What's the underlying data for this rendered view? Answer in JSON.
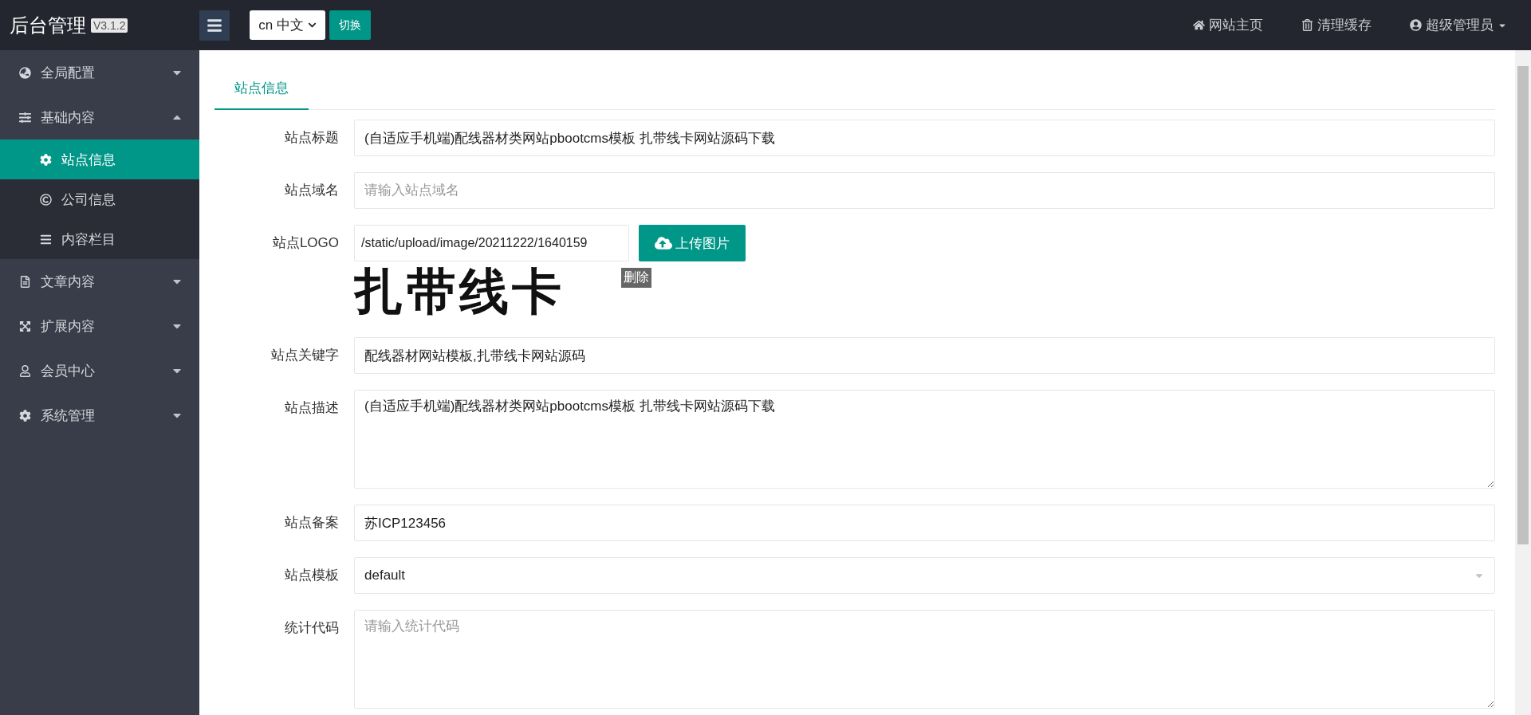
{
  "header": {
    "brand": "后台管理",
    "version": "V3.1.2",
    "language_select": {
      "value": "cn 中文"
    },
    "switch_button": "切换",
    "links": [
      {
        "kind": "home",
        "label": "网站主页"
      },
      {
        "kind": "trash",
        "label": "清理缓存"
      },
      {
        "kind": "user",
        "label": "超级管理员"
      }
    ]
  },
  "sidebar": {
    "items": [
      {
        "label": "全局配置",
        "expanded": false
      },
      {
        "label": "基础内容",
        "expanded": true,
        "children": [
          {
            "label": "站点信息",
            "selected": true
          },
          {
            "label": "公司信息",
            "selected": false
          },
          {
            "label": "内容栏目",
            "selected": false
          }
        ]
      },
      {
        "label": "文章内容",
        "expanded": false
      },
      {
        "label": "扩展内容",
        "expanded": false
      },
      {
        "label": "会员中心",
        "expanded": false
      },
      {
        "label": "系统管理",
        "expanded": false
      }
    ]
  },
  "tabs": [
    {
      "label": "站点信息",
      "selected": true
    }
  ],
  "form": {
    "fields": [
      {
        "kind": "text",
        "label": "站点标题",
        "value": "(自适应手机端)配线器材类网站pbootcms模板 扎带线卡网站源码下载"
      },
      {
        "kind": "text",
        "label": "站点域名",
        "placeholder": "请输入站点域名"
      },
      {
        "kind": "upload",
        "label": "站点LOGO",
        "value": "/static/upload/image/20211222/1640159",
        "button": "上传图片",
        "delete": "删除",
        "preview": "扎带线卡"
      },
      {
        "kind": "text",
        "label": "站点关键字",
        "value": "配线器材网站模板,扎带线卡网站源码"
      },
      {
        "kind": "textarea",
        "label": "站点描述",
        "value": "(自适应手机端)配线器材类网站pbootcms模板 扎带线卡网站源码下载"
      },
      {
        "kind": "text",
        "label": "站点备案",
        "value": "苏ICP123456"
      },
      {
        "kind": "select",
        "label": "站点模板",
        "value": "default"
      },
      {
        "kind": "textarea",
        "label": "统计代码",
        "placeholder": "请输入统计代码"
      }
    ]
  }
}
